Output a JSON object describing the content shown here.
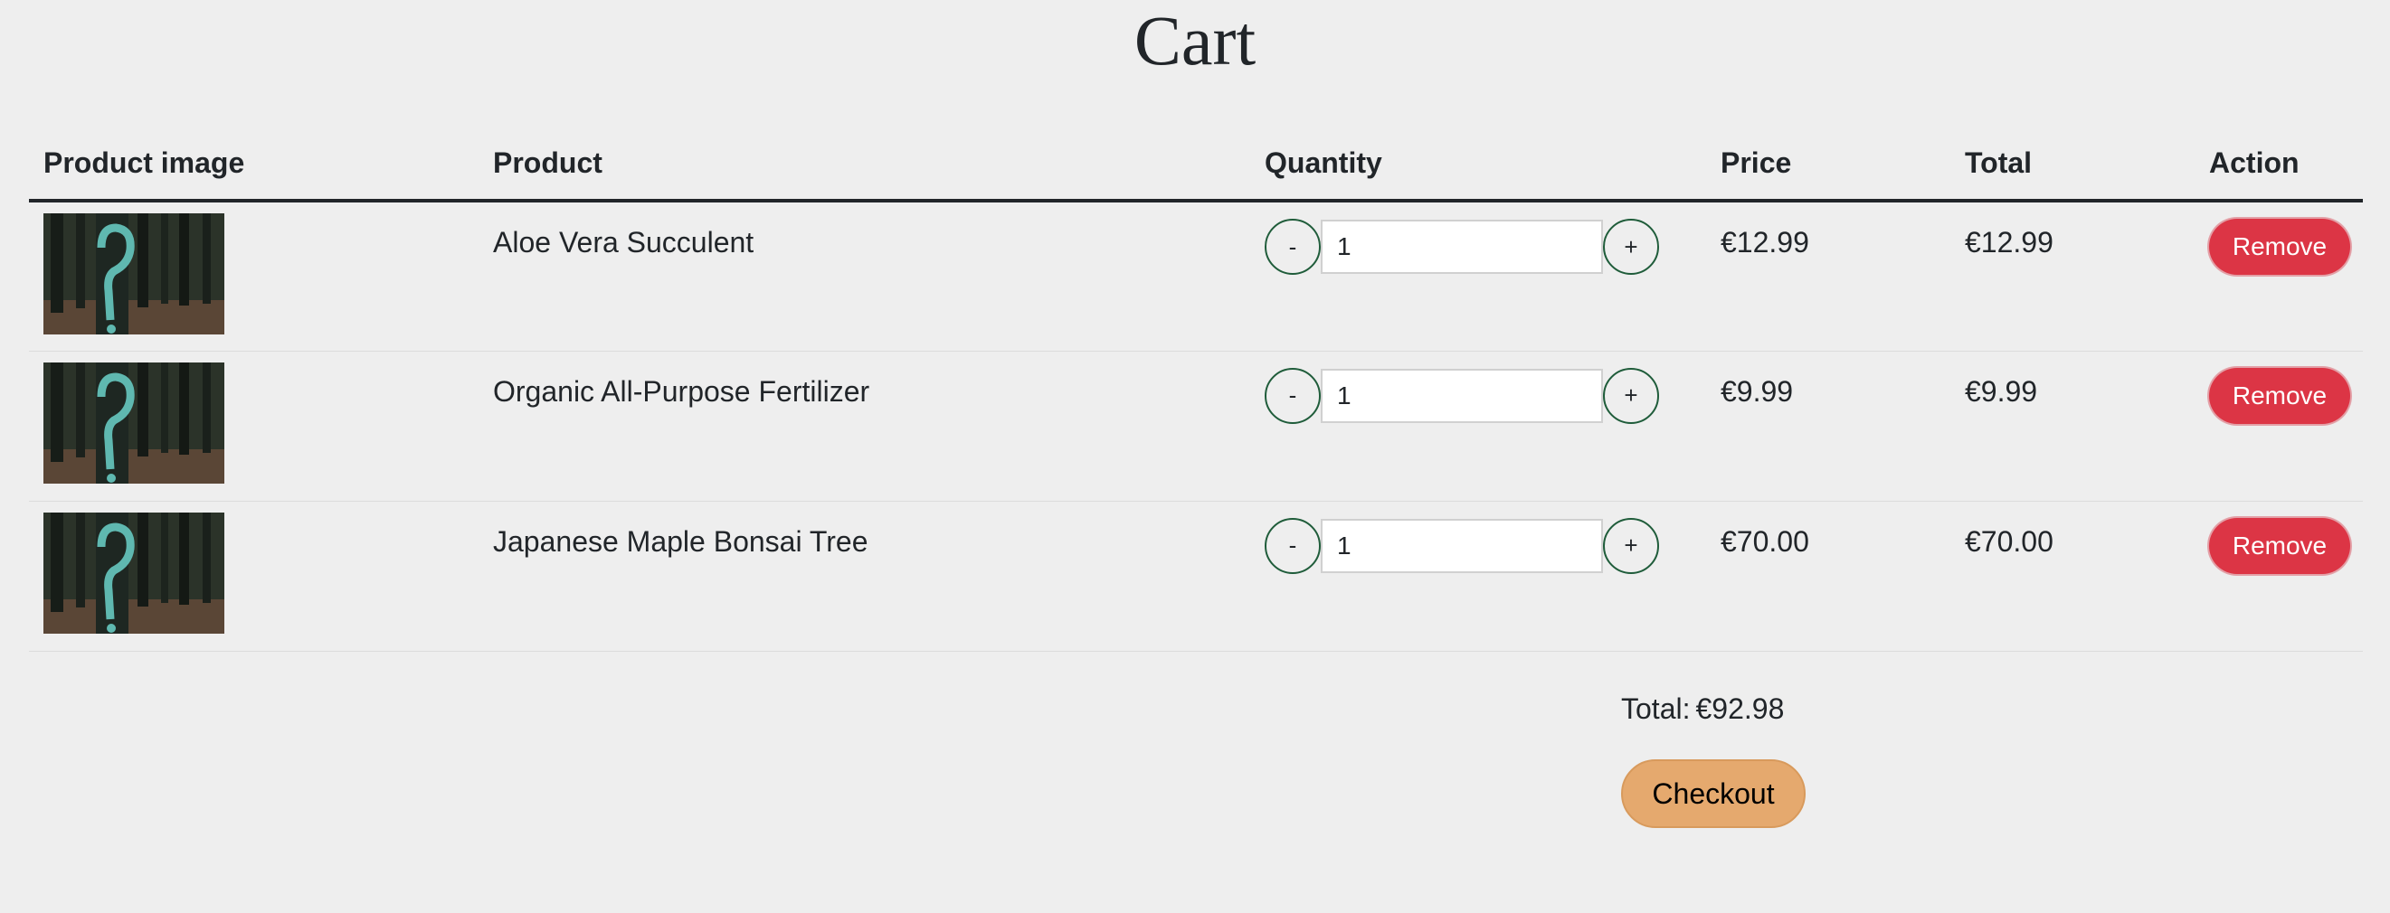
{
  "page": {
    "title": "Cart"
  },
  "table": {
    "headers": {
      "image": "Product image",
      "product": "Product",
      "quantity": "Quantity",
      "price": "Price",
      "total": "Total",
      "action": "Action"
    },
    "rows": [
      {
        "product": "Aloe Vera Succulent",
        "quantity": "1",
        "price": "€12.99",
        "total": "€12.99",
        "remove_label": "Remove",
        "minus_label": "-",
        "plus_label": "+"
      },
      {
        "product": "Organic All-Purpose Fertilizer",
        "quantity": "1",
        "price": "€9.99",
        "total": "€9.99",
        "remove_label": "Remove",
        "minus_label": "-",
        "plus_label": "+"
      },
      {
        "product": "Japanese Maple Bonsai Tree",
        "quantity": "1",
        "price": "€70.00",
        "total": "€70.00",
        "remove_label": "Remove",
        "minus_label": "-",
        "plus_label": "+"
      }
    ]
  },
  "summary": {
    "total_label": "Total:",
    "total_value": "€92.98",
    "checkout_label": "Checkout"
  },
  "colors": {
    "background": "#eeeeee",
    "remove_button": "#dc3545",
    "checkout_button": "#e5a96e",
    "stepper_border": "#1f5c3a"
  }
}
